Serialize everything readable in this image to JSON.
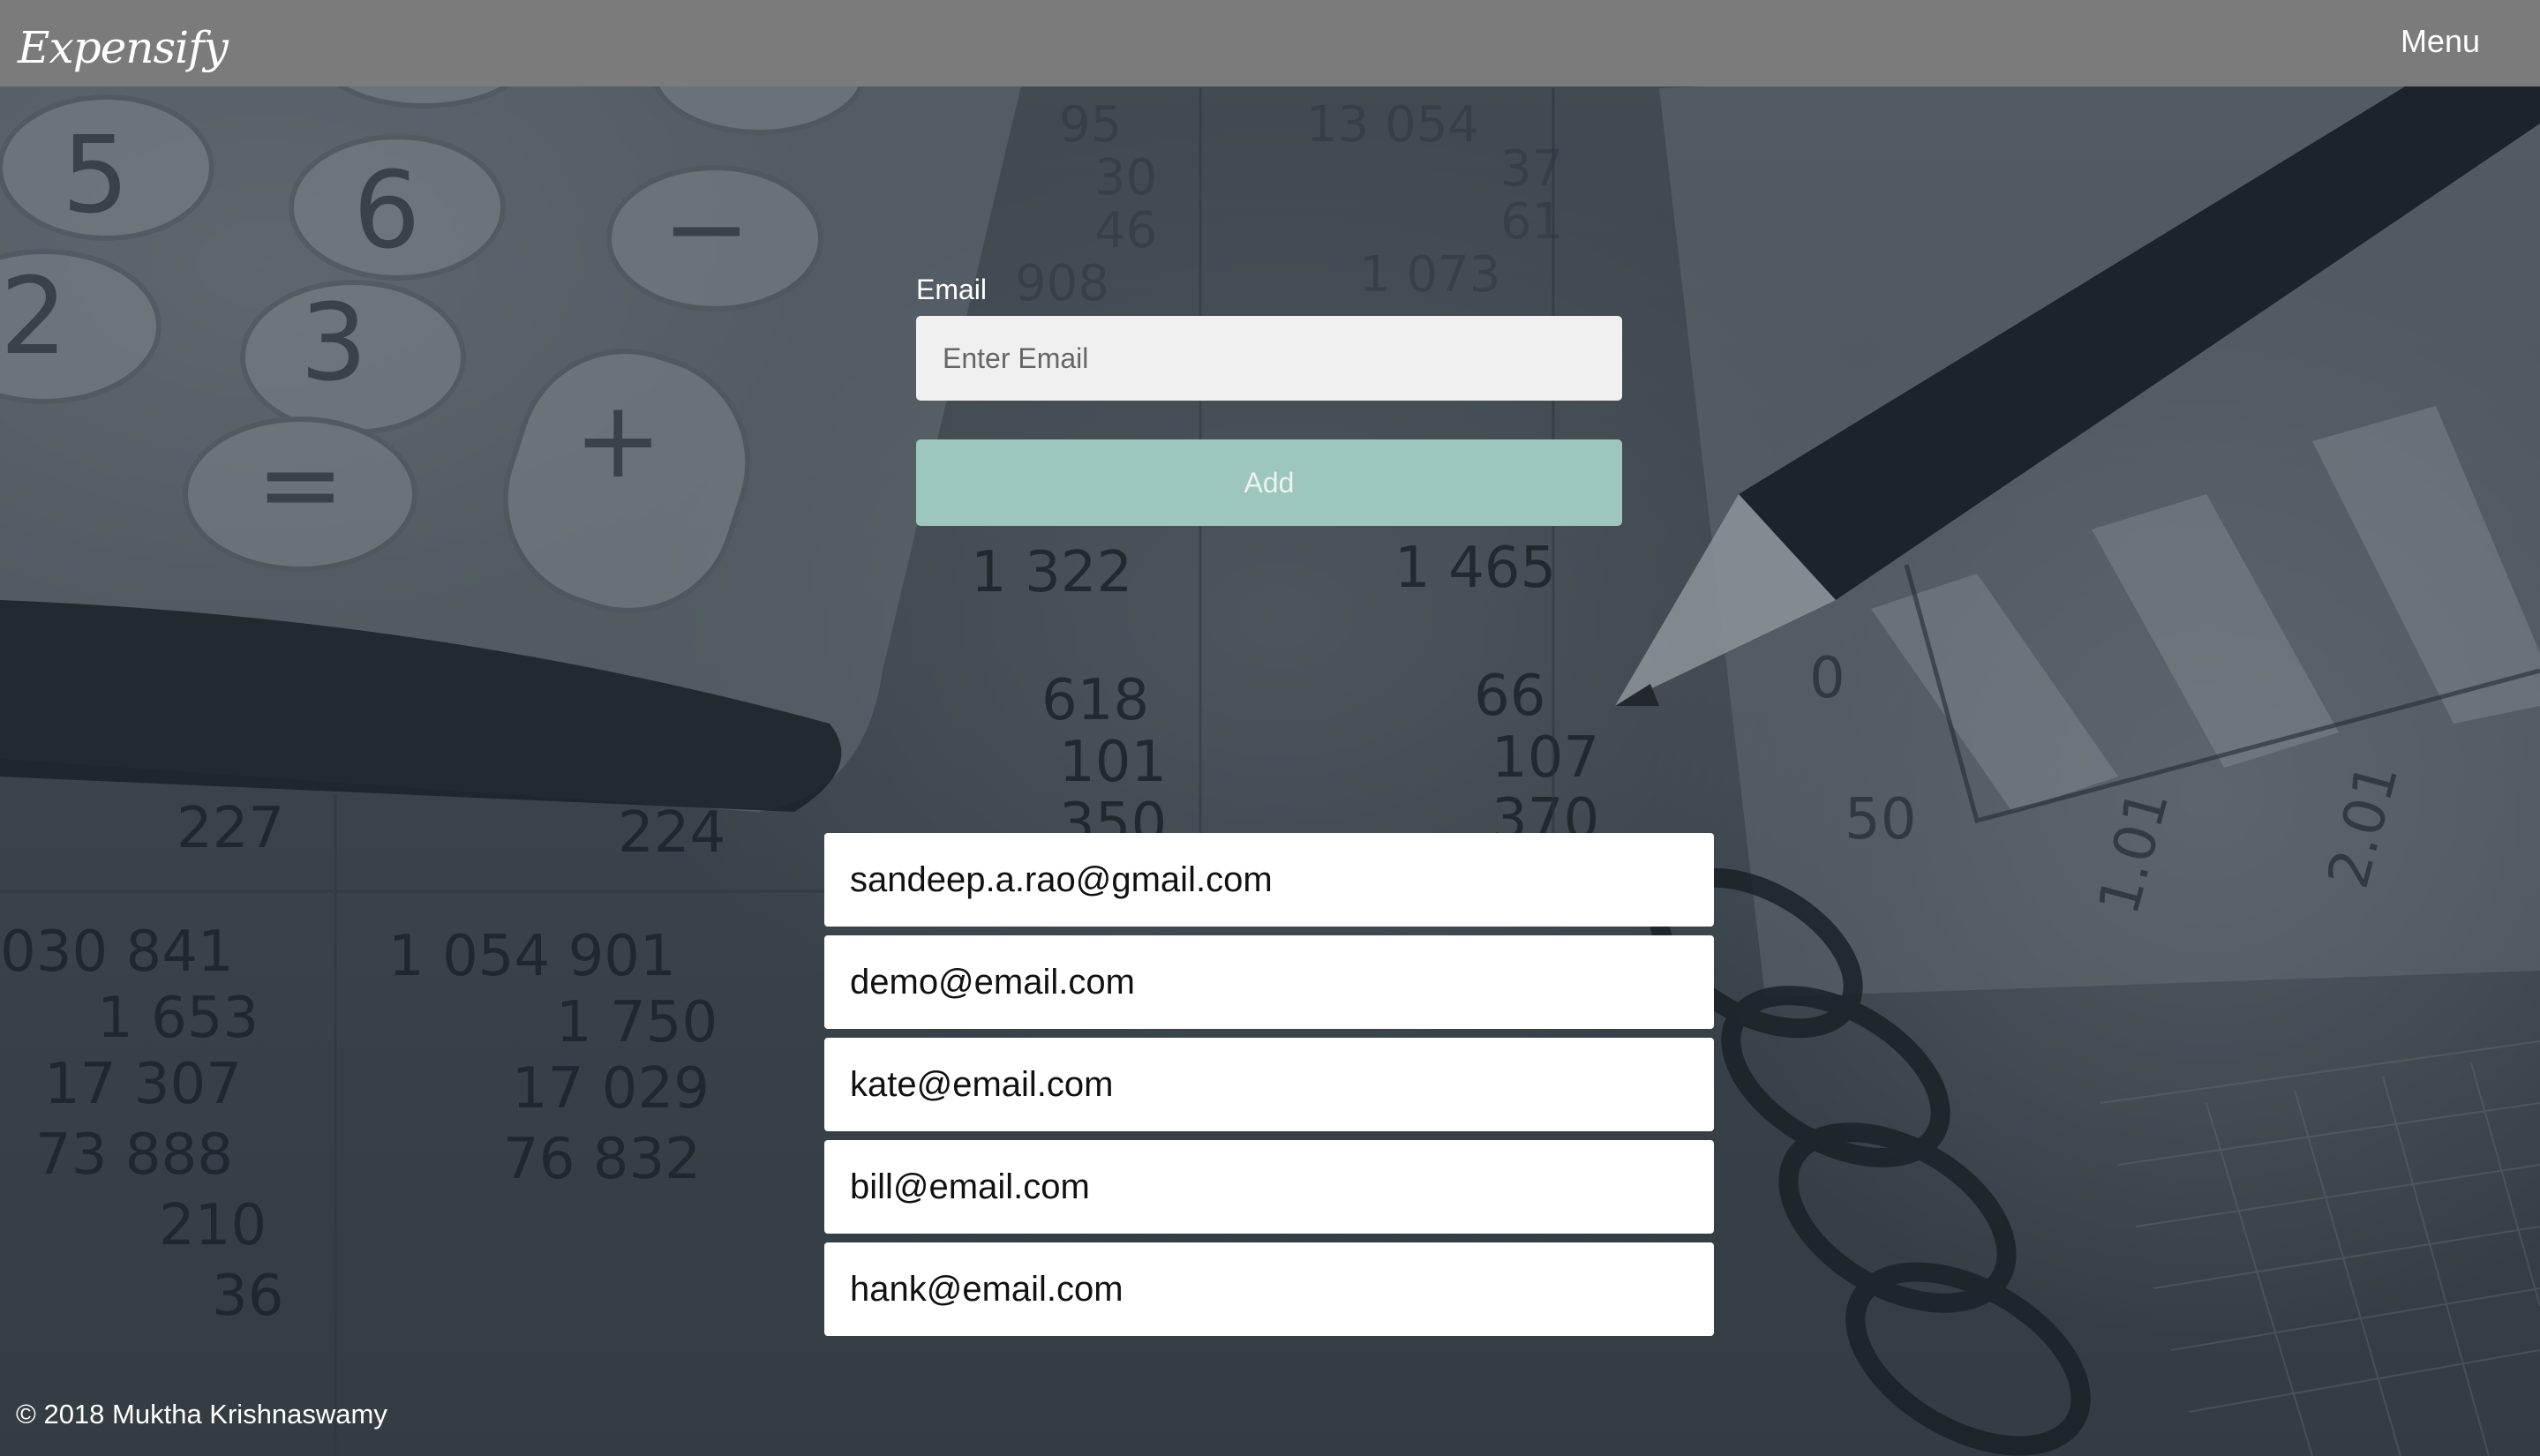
{
  "header": {
    "brand": "Expensify",
    "menu_label": "Menu",
    "background_color": "#7b7b7b"
  },
  "form": {
    "email_label": "Email",
    "email_placeholder": "Enter Email",
    "email_value": "",
    "add_label": "Add",
    "add_button_color": "#9dc6be"
  },
  "emails": [
    "sandeep.a.rao@gmail.com",
    "demo@email.com",
    "kate@email.com",
    "bill@email.com",
    "hank@email.com"
  ],
  "footer": {
    "copyright": "© 2018 Muktha Krishnaswamy"
  }
}
